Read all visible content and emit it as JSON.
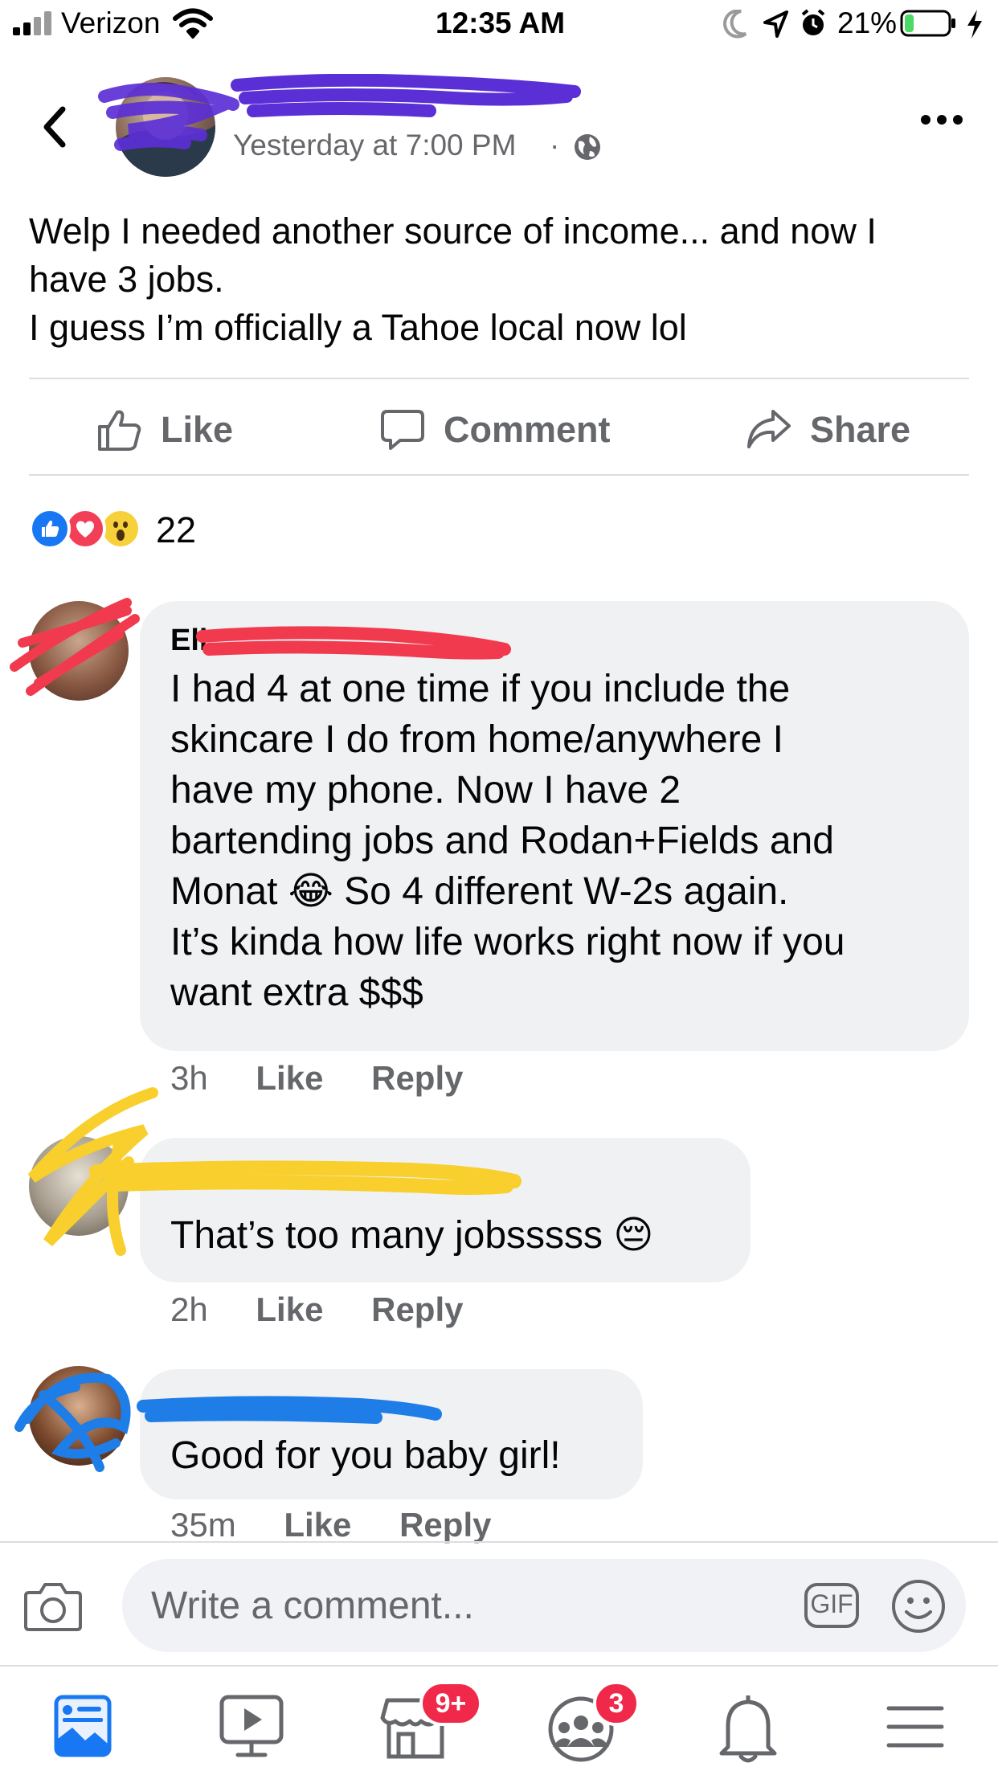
{
  "status_bar": {
    "carrier": "Verizon",
    "time": "12:35 AM",
    "battery": "21%",
    "battery_level": 0.21
  },
  "post": {
    "author": "",
    "timestamp": "Yesterday at 7:00 PM",
    "separator": "·",
    "privacy_icon": "globe-icon",
    "text_lines": [
      "Welp I needed another source of income... and now I",
      "have 3 jobs.",
      "I guess I’m officially a Tahoe local now lol"
    ]
  },
  "actions": {
    "like": "Like",
    "comment": "Comment",
    "share": "Share"
  },
  "reactions": {
    "types": [
      "like",
      "love",
      "wow"
    ],
    "count": "22"
  },
  "comments": [
    {
      "author": "Eli",
      "text_lines": [
        "I had 4 at one time if you include the",
        "skincare I do from home/anywhere I",
        "have my phone. Now I have 2",
        "bartending jobs and Rodan+Fields and",
        "Monat 😂 So 4 different W-2s again.",
        "It’s kinda how life works right now if you",
        "want extra $$$"
      ],
      "time": "3h",
      "like": "Like",
      "reply": "Reply"
    },
    {
      "author": "",
      "text_lines": [
        "That’s too many jobsssss 😔"
      ],
      "time": "2h",
      "like": "Like",
      "reply": "Reply"
    },
    {
      "author": "",
      "text_lines": [
        "Good for you baby girl!"
      ],
      "time": "35m",
      "like": "Like",
      "reply": "Reply"
    }
  ],
  "composer": {
    "placeholder": "Write a comment...",
    "gif_label": "GIF"
  },
  "tabbar": {
    "items": [
      {
        "icon": "news-feed-icon"
      },
      {
        "icon": "watch-icon"
      },
      {
        "icon": "marketplace-icon",
        "badge": "9+"
      },
      {
        "icon": "groups-icon",
        "badge": "3"
      },
      {
        "icon": "notifications-icon"
      },
      {
        "icon": "menu-icon"
      }
    ]
  },
  "colors": {
    "accent": "#1877f2",
    "badge": "#f02849",
    "secondary_text": "#65676b",
    "bubble": "#eff1f3",
    "redaction_purple": "#5b2fd6",
    "redaction_red": "#f23a4e",
    "redaction_yellow": "#f8cf2c",
    "redaction_blue": "#1e7de6"
  }
}
